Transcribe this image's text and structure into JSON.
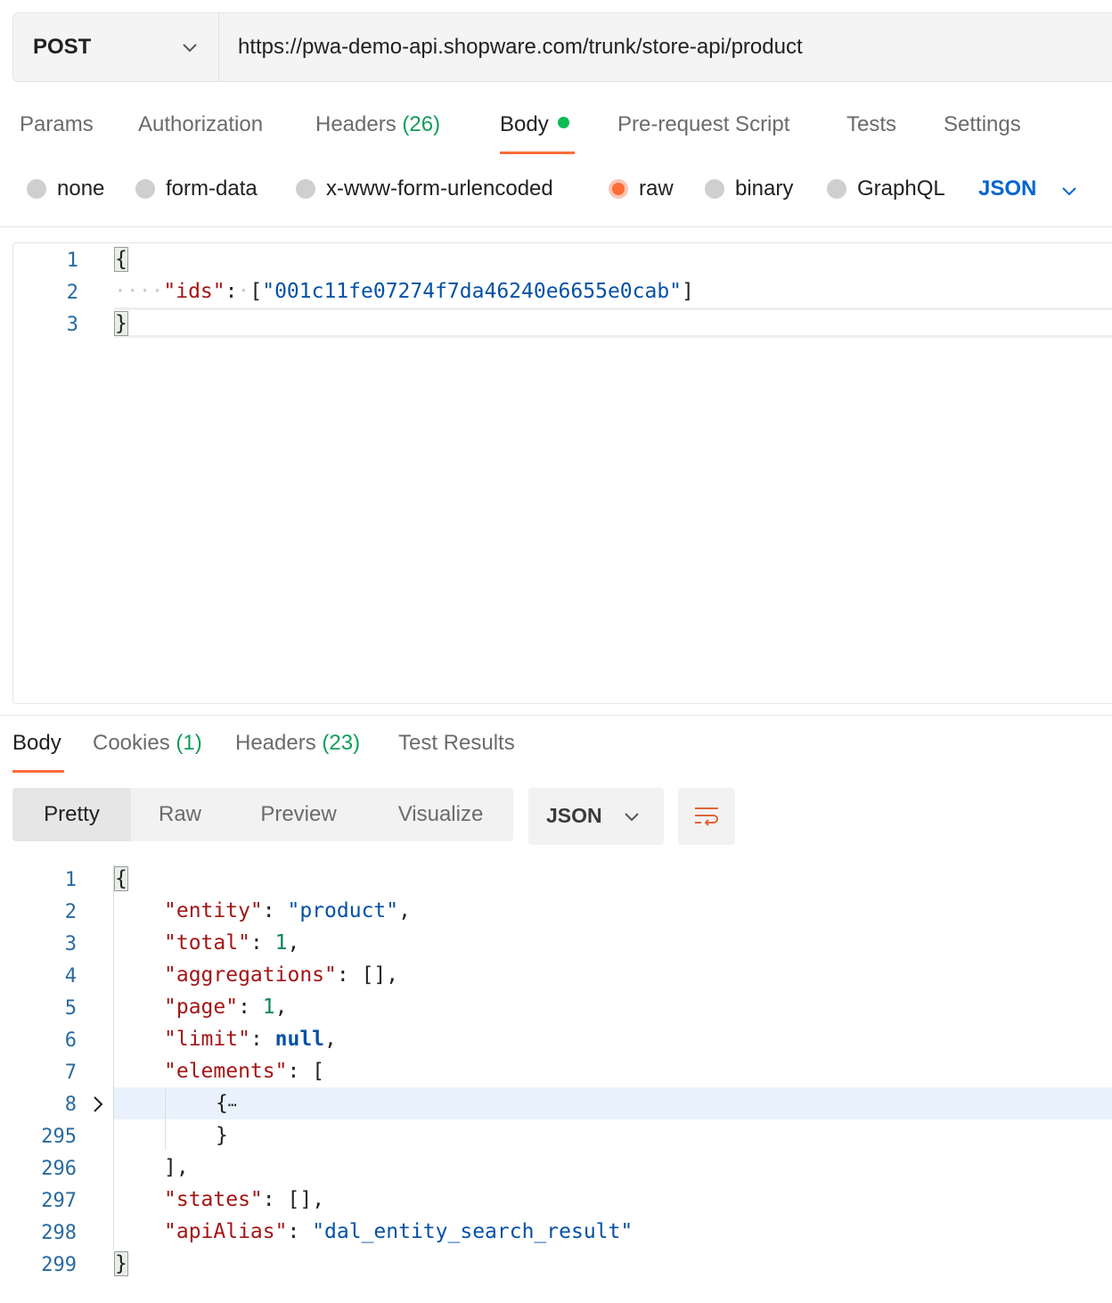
{
  "request": {
    "method": "POST",
    "url": "https://pwa-demo-api.shopware.com/trunk/store-api/product"
  },
  "request_tabs": {
    "params": "Params",
    "authorization": "Authorization",
    "headers": "Headers",
    "headers_count": "(26)",
    "body": "Body",
    "prerequest": "Pre-request Script",
    "tests": "Tests",
    "settings": "Settings"
  },
  "body_types": {
    "none": "none",
    "form_data": "form-data",
    "urlencoded": "x-www-form-urlencoded",
    "raw": "raw",
    "binary": "binary",
    "graphql": "GraphQL",
    "language": "JSON"
  },
  "request_body": {
    "line_numbers": [
      "1",
      "2",
      "3"
    ],
    "open": "{",
    "key": "\"ids\"",
    "colon": ":",
    "value_open": "[",
    "value": "\"001c11fe07274f7da46240e6655e0cab\"",
    "value_close": "]",
    "close": "}"
  },
  "response_tabs": {
    "body": "Body",
    "cookies": "Cookies",
    "cookies_count": "(1)",
    "headers": "Headers",
    "headers_count": "(23)",
    "test_results": "Test Results"
  },
  "response_views": {
    "pretty": "Pretty",
    "raw": "Raw",
    "preview": "Preview",
    "visualize": "Visualize",
    "format": "JSON"
  },
  "response_body": {
    "line_numbers": [
      "1",
      "2",
      "3",
      "4",
      "5",
      "6",
      "7",
      "8",
      "295",
      "296",
      "297",
      "298",
      "299"
    ],
    "open": "{",
    "entity_key": "\"entity\"",
    "entity_val": "\"product\"",
    "total_key": "\"total\"",
    "total_val": "1",
    "aggregations_key": "\"aggregations\"",
    "aggregations_val": "[]",
    "page_key": "\"page\"",
    "page_val": "1",
    "limit_key": "\"limit\"",
    "limit_val": "null",
    "elements_key": "\"elements\"",
    "elements_open": "[",
    "collapsed_open": "{",
    "ellipsis": "⋯",
    "collapsed_close": "}",
    "elements_close": "],",
    "states_key": "\"states\"",
    "states_val": "[]",
    "apialias_key": "\"apiAlias\"",
    "apialias_val": "\"dal_entity_search_result\"",
    "close": "}"
  },
  "icons": {
    "method_chevron": "chevron-down-icon",
    "language_chevron": "chevron-down-icon",
    "fold_arrow": "chevron-right-icon",
    "wrap": "wrap-lines-icon"
  },
  "colors": {
    "accent": "#ff6c37",
    "link_blue": "#0265d2",
    "count_green": "#0f9d58"
  }
}
